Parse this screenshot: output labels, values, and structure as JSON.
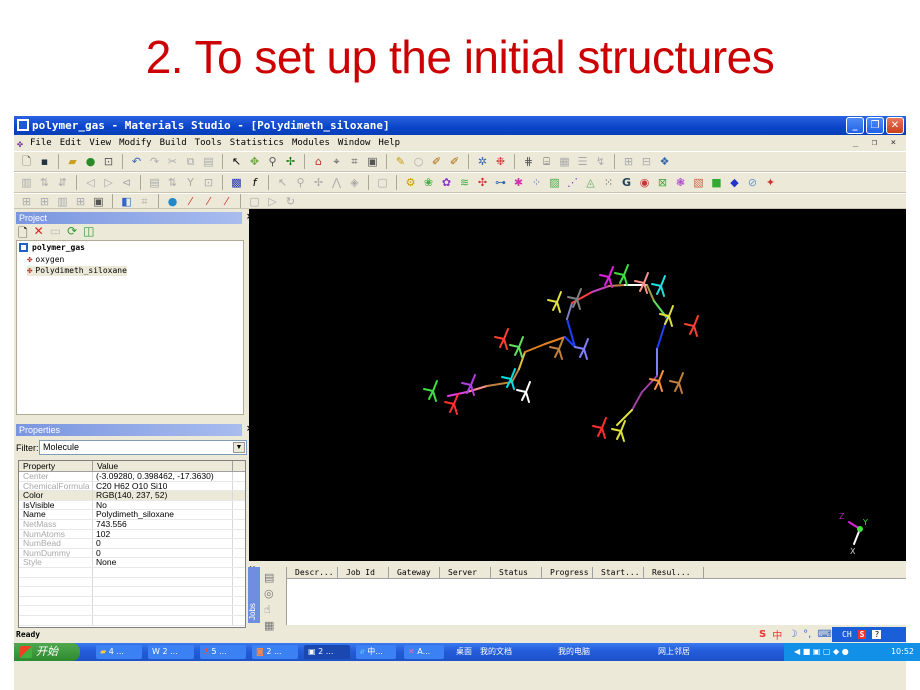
{
  "slide": {
    "title": "2. To set up the initial structures"
  },
  "window": {
    "title": "polymer_gas - Materials Studio - [Polydimeth_siloxane]",
    "controls": {
      "minimize": "_",
      "restore": "❐",
      "close": "✕"
    },
    "mdi_controls": "_ ❐ ×"
  },
  "menubar": {
    "items": [
      "File",
      "Edit",
      "View",
      "Modify",
      "Build",
      "Tools",
      "Statistics",
      "Modules",
      "Window",
      "Help"
    ]
  },
  "toolbars": {
    "row1": [
      "new-icon",
      "save-icon",
      "open-icon",
      "globe-icon",
      "window-icon",
      "undo-icon",
      "redo-icon",
      "cut-icon",
      "copy-icon",
      "paste-icon",
      "select-arrow-icon",
      "rotate-icon",
      "zoom-icon",
      "translate-icon",
      "house-icon",
      "target-icon",
      "fit-icon",
      "display-style-icon",
      "pencil-icon",
      "ring-icon",
      "color-by-icon",
      "label-icon",
      "cleanup-icon",
      "molecule-icon",
      "hydrogen-icon",
      "align-icon",
      "grid-icon",
      "bars-icon",
      "chart-icon",
      "lattice-icon",
      "cell-icon",
      "crystal-icon"
    ],
    "row2": [
      "table-icon",
      "sort-asc-icon",
      "sort-desc-icon",
      "prev-icon",
      "next-icon",
      "link-icon",
      "columns-icon",
      "sort-icon",
      "filter-icon",
      "freeze-icon",
      "chart-icon",
      "function-icon",
      "pointer-icon",
      "zoom-icon",
      "move-icon",
      "sketch-icon",
      "erase-icon",
      "document-icon",
      "calc-icon",
      "module-1-icon",
      "module-2-icon",
      "module-3-icon",
      "module-4-icon",
      "module-5-icon",
      "module-6-icon",
      "module-7-icon",
      "module-8-icon",
      "module-9-icon",
      "module-10-icon",
      "module-g-icon",
      "module-target-icon",
      "module-11-icon",
      "module-12-icon",
      "module-13-icon",
      "module-14-icon",
      "module-15-icon",
      "module-16-icon",
      "module-17-icon",
      "module-18-icon"
    ],
    "row3": [
      "table-a-icon",
      "table-b-icon",
      "table-c-icon",
      "table-d-icon",
      "properties-icon",
      "atom-icon",
      "bond-icon",
      "sphere-icon",
      "stick-icon",
      "bond-2-icon",
      "hbond-icon",
      "script-icon",
      "play-icon",
      "stop-icon"
    ]
  },
  "project": {
    "title": "Project",
    "close": "×",
    "root": "polymer_gas",
    "children": [
      "oxygen",
      "Polydimeth_siloxane"
    ]
  },
  "properties": {
    "title": "Properties",
    "close": "×",
    "filter_label": "Filter:",
    "filter_value": "Molecule",
    "columns": [
      "Property",
      "Value"
    ],
    "rows": [
      {
        "name": "Center",
        "value": "(-3.09280, 0.398462, -17.3630)",
        "dim": true
      },
      {
        "name": "ChemicalFormula",
        "value": "C20 H62 O10 Si10",
        "dim": true
      },
      {
        "name": "Color",
        "value": "RGB(140, 237, 52)",
        "dim": false
      },
      {
        "name": "IsVisible",
        "value": "No",
        "dim": false
      },
      {
        "name": "Name",
        "value": "Polydimeth_siloxane",
        "dim": false
      },
      {
        "name": "NetMass",
        "value": "743.556",
        "dim": true
      },
      {
        "name": "NumAtoms",
        "value": "102",
        "dim": true
      },
      {
        "name": "NumBead",
        "value": "0",
        "dim": true
      },
      {
        "name": "NumDummy",
        "value": "0",
        "dim": true
      },
      {
        "name": "Style",
        "value": "None",
        "dim": true
      }
    ],
    "empty_rows": 6
  },
  "viewport": {
    "axes": {
      "x": "X",
      "y": "Y",
      "z": "Z"
    }
  },
  "jobs": {
    "side_label": "Jobs",
    "close": "×",
    "columns": [
      "Descr...",
      "Job Id",
      "Gateway",
      "Server",
      "Status",
      "Progress",
      "Start...",
      "Resul..."
    ]
  },
  "status": {
    "text": "Ready"
  },
  "ime": {
    "lang": "CH",
    "mode": "中"
  },
  "taskbar": {
    "start": "开始",
    "buttons": [
      {
        "label": "4 ..."
      },
      {
        "label": "2 ..."
      },
      {
        "label": "5 ..."
      },
      {
        "label": "2 ..."
      },
      {
        "label": "2 ..."
      },
      {
        "label": "中..."
      },
      {
        "label": "A..."
      }
    ],
    "desktop_links": [
      "桌面",
      "我的文档",
      "我的电脑",
      "网上邻居"
    ],
    "clock": "10:52"
  }
}
